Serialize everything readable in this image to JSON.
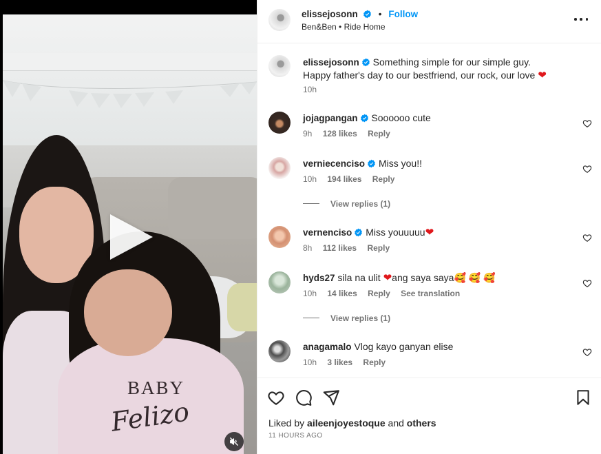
{
  "post": {
    "author": "elissejosonn",
    "follow_label": "Follow",
    "separator": "•",
    "audio": "Ben&Ben • Ride Home",
    "caption_line1": "Something simple for our simple guy.",
    "caption_line2": "Happy father's day to our bestfriend, our rock, our love",
    "caption_time": "10h",
    "shirt_text_1": "BABY",
    "shirt_text_2": "Felizo"
  },
  "comments": [
    {
      "user": "jojagpangan",
      "text": "Soooooo cute",
      "time": "9h",
      "likes": "128 likes",
      "reply": "Reply",
      "verified": true
    },
    {
      "user": "verniecenciso",
      "text": "Miss you!!",
      "time": "10h",
      "likes": "194 likes",
      "reply": "Reply",
      "verified": true,
      "view_replies": "View replies (1)"
    },
    {
      "user": "vernenciso",
      "text": "Miss youuuuu",
      "time": "8h",
      "likes": "112 likes",
      "reply": "Reply",
      "verified": true
    },
    {
      "user": "hyds27",
      "text_a": "sila na ulit",
      "text_b": "ang saya saya",
      "time": "10h",
      "likes": "14 likes",
      "reply": "Reply",
      "translate": "See translation",
      "view_replies": "View replies (1)"
    },
    {
      "user": "anagamalo",
      "text": "Vlog kayo ganyan elise",
      "time": "10h",
      "likes": "3 likes",
      "reply": "Reply"
    }
  ],
  "footer": {
    "liked_by_prefix": "Liked by",
    "liked_by_user": "aileenjoyestoque",
    "liked_by_and": "and",
    "liked_by_others": "others",
    "time_ago": "11 HOURS AGO"
  },
  "icons": {
    "verified": "verified-badge-icon",
    "more": "more-options-icon",
    "like": "heart-icon",
    "comment": "comment-icon",
    "share": "share-icon",
    "save": "bookmark-icon",
    "play": "play-icon",
    "mute": "muted-speaker-icon"
  },
  "colors": {
    "accent": "#0095f6",
    "heart": "#e0181c",
    "muted_text": "#737373"
  }
}
